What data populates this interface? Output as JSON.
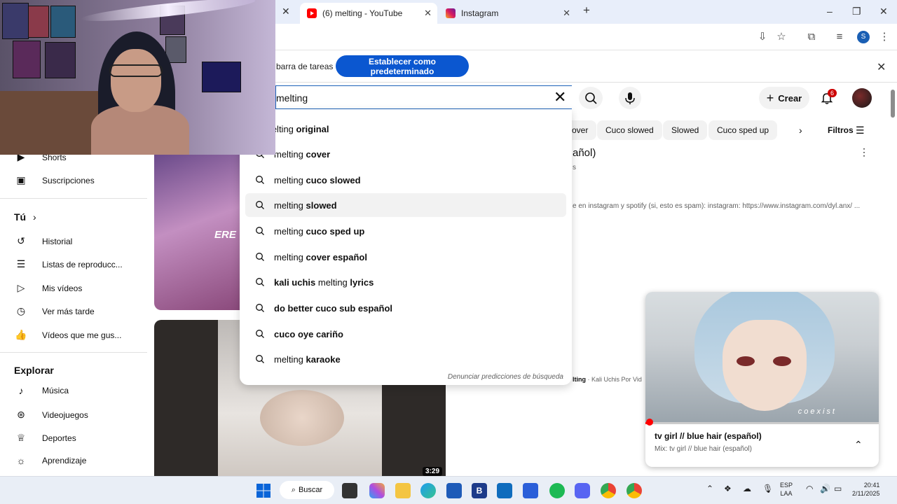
{
  "browser": {
    "tabs": [
      {
        "label": "(6) melting - YouTube",
        "active": true
      },
      {
        "label": "Instagram",
        "active": false
      }
    ],
    "new_tab": "+",
    "window_controls": [
      "–",
      "❐",
      "✕"
    ]
  },
  "infobar": {
    "text": "barra de tareas",
    "button": "Establecer como predeterminado",
    "close": "✕"
  },
  "youtube": {
    "search": {
      "value": "melting"
    },
    "create_label": "Crear",
    "notifications": "6",
    "chips": [
      "over",
      "Cuco slowed",
      "Slowed",
      "Cuco sped up"
    ],
    "filters_label": "Filtros"
  },
  "suggestions": {
    "items": [
      {
        "plain": "melting",
        "bold": " original"
      },
      {
        "plain": "melting",
        "bold": " cover"
      },
      {
        "plain": "melting",
        "bold": " cuco slowed"
      },
      {
        "plain": "melting",
        "bold": " slowed"
      },
      {
        "plain": "melting",
        "bold": " cuco sped up"
      },
      {
        "plain": "melting",
        "bold": " cover español"
      },
      {
        "prefix": "kali uchis ",
        "plain": "melting",
        "bold": " lyrics"
      },
      {
        "prefix": "do better cuco sub español",
        "plain": "",
        "bold": ""
      },
      {
        "prefix": "cuco oye cariño",
        "plain": "",
        "bold": ""
      },
      {
        "plain": "melting",
        "bold": " karaoke"
      }
    ],
    "report": "Denunciar predicciones de búsqueda"
  },
  "sidebar": {
    "top_items": [
      {
        "label": "Shorts",
        "icon": "shorts-icon"
      },
      {
        "label": "Suscripciones",
        "icon": "subscriptions-icon"
      }
    ],
    "you_heading": "Tú",
    "you_items": [
      {
        "label": "Historial",
        "icon": "history-icon"
      },
      {
        "label": "Listas de reproducc...",
        "icon": "playlist-icon"
      },
      {
        "label": "Mis vídeos",
        "icon": "my-videos-icon"
      },
      {
        "label": "Ver más tarde",
        "icon": "clock-icon"
      },
      {
        "label": "Vídeos que me gus...",
        "icon": "thumbs-up-icon"
      }
    ],
    "explore_heading": "Explorar",
    "explore_items": [
      {
        "label": "Música",
        "icon": "music-icon"
      },
      {
        "label": "Videojuegos",
        "icon": "gaming-icon"
      },
      {
        "label": "Deportes",
        "icon": "trophy-icon"
      },
      {
        "label": "Aprendizaje",
        "icon": "bulb-icon"
      }
    ]
  },
  "results": {
    "thumb1_text": "ERE",
    "title_partial": "añol)",
    "sub_partial": "s",
    "desc_partial": "e en instagram y spotify (si, esto es spam): instagram: https://www.instagram.com/dyl.anx/ ...",
    "second_partial_bold": "lting",
    "second_partial": " · Kali Uchis Por Vid",
    "duration": "3:29"
  },
  "miniplayer": {
    "caption": "coexist",
    "title": "tv girl // blue hair (español)",
    "subtitle": "Mix: tv girl // blue hair (español)",
    "progress": 0.02
  },
  "taskbar": {
    "search_label": "Buscar",
    "lang": "ESP",
    "lang_sub": "LAA",
    "time": "20:41",
    "date": "2/11/2025"
  }
}
